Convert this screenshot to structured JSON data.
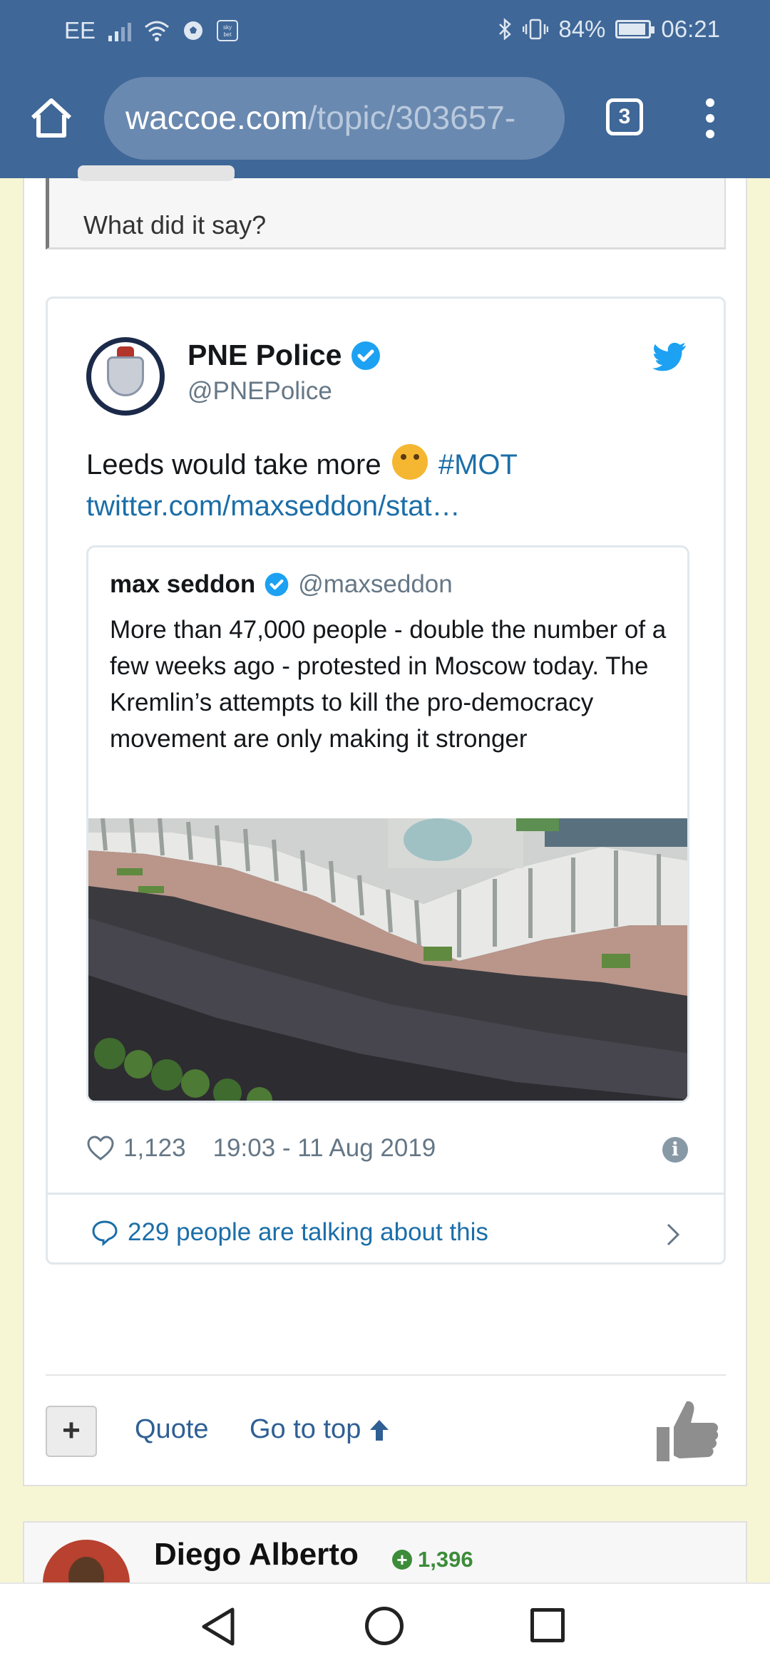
{
  "status_bar": {
    "carrier": "EE",
    "sky_icon_text": "sky bet",
    "battery": "84%",
    "battery_level": 0.84,
    "time": "06:21"
  },
  "browser": {
    "url_host": "waccoe.com",
    "url_path": "/topic/303657-",
    "tab_count": "3",
    "icons": [
      "home-icon",
      "tabs-icon",
      "overflow-menu-icon"
    ]
  },
  "quoted_post": {
    "text": "What did it say?"
  },
  "tweet": {
    "name": "PNE Police",
    "handle": "@PNEPolice",
    "body_text": "Leeds would take more",
    "hashtag": "#MOT",
    "link": "twitter.com/maxseddon/stat…",
    "embedded": {
      "name": "max seddon",
      "handle": "@maxseddon",
      "text": "More than 47,000 people - double the number of a few weeks ago - protested in Moscow today. The Kremlin’s attempts to kill the pro-democracy movement are only making it stronger"
    },
    "likes": "1,123",
    "timestamp": "19:03 - 11 Aug 2019",
    "talking": "229 people are talking about this",
    "colors": {
      "twitter_blue": "#1da1f2",
      "link_blue": "#1b6ea8"
    }
  },
  "post_actions": {
    "plus": "+",
    "quote": "Quote",
    "go_to_top": "Go to top"
  },
  "next_post": {
    "author": "Diego Alberto",
    "reputation": "1,396"
  },
  "colors": {
    "header": "#3f6798",
    "page_bg": "#f7f6d4"
  }
}
